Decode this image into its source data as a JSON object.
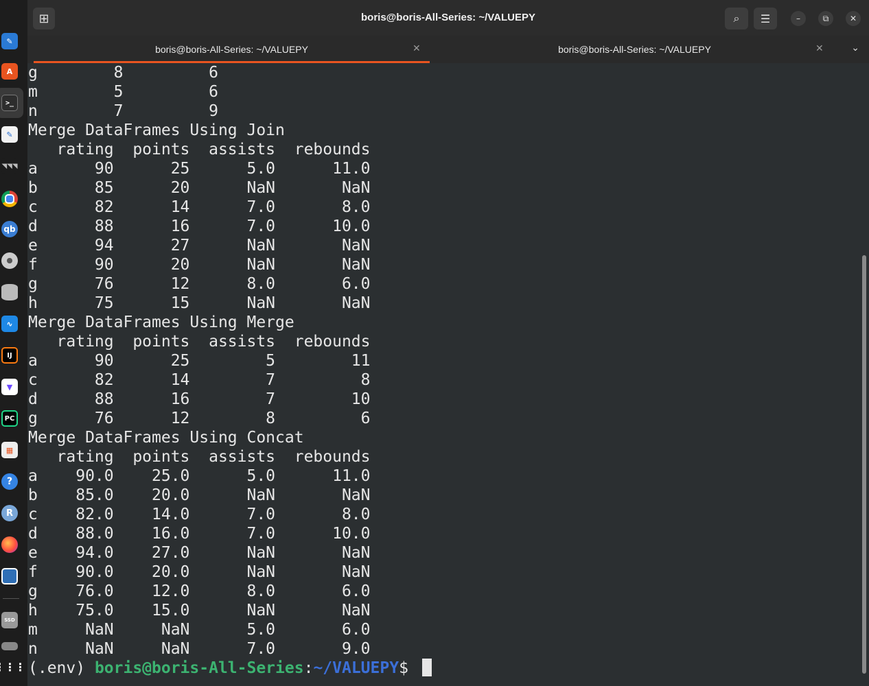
{
  "window": {
    "title": "boris@boris-All-Series: ~/VALUEPY",
    "new_tab_icon": "new-tab-icon",
    "search_icon": "search-icon",
    "menu_icon": "hamburger-menu-icon",
    "minimize_glyph": "–",
    "maximize_glyph": "⧉",
    "close_glyph": "✕"
  },
  "tabs": [
    {
      "label": "boris@boris-All-Series: ~/VALUEPY",
      "active": true
    },
    {
      "label": "boris@boris-All-Series: ~/VALUEPY",
      "active": false
    }
  ],
  "dock": {
    "items": [
      "libreoffice-writer-icon",
      "app-store-icon",
      "terminal-icon",
      "text-editor-icon",
      "gnome-icon",
      "chrome-icon",
      "qbittorrent-icon",
      "disc-icon",
      "database-icon",
      "system-monitor-icon",
      "intellij-icon",
      "proton-vpn-icon",
      "pycharm-icon",
      "settings-icon",
      "help-icon",
      "r-icon",
      "firefox-icon",
      "screenshot-icon",
      "ssd-drive-icon",
      "usb-drive-icon",
      "app-grid-icon"
    ]
  },
  "terminal": {
    "lines": [
      "g        8         6",
      "m        5         6",
      "n        7         9",
      "Merge DataFrames Using Join",
      "   rating  points  assists  rebounds",
      "a      90      25      5.0      11.0",
      "b      85      20      NaN       NaN",
      "c      82      14      7.0       8.0",
      "d      88      16      7.0      10.0",
      "e      94      27      NaN       NaN",
      "f      90      20      NaN       NaN",
      "g      76      12      8.0       6.0",
      "h      75      15      NaN       NaN",
      "Merge DataFrames Using Merge",
      "   rating  points  assists  rebounds",
      "a      90      25        5        11",
      "c      82      14        7         8",
      "d      88      16        7        10",
      "g      76      12        8         6",
      "Merge DataFrames Using Concat",
      "   rating  points  assists  rebounds",
      "a    90.0    25.0      5.0      11.0",
      "b    85.0    20.0      NaN       NaN",
      "c    82.0    14.0      7.0       8.0",
      "d    88.0    16.0      7.0      10.0",
      "e    94.0    27.0      NaN       NaN",
      "f    90.0    20.0      NaN       NaN",
      "g    76.0    12.0      8.0       6.0",
      "h    75.0    15.0      NaN       NaN",
      "m     NaN     NaN      5.0       6.0",
      "n     NaN     NaN      7.0       9.0"
    ],
    "prompt": {
      "env": "(.env) ",
      "user_host": "boris@boris-All-Series",
      "colon": ":",
      "path": "~/VALUEPY",
      "symbol": "$ "
    }
  }
}
